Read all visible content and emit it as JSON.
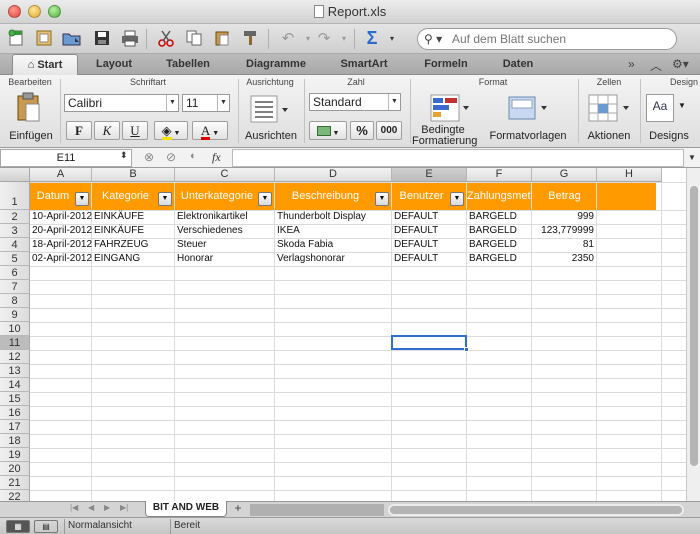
{
  "window": {
    "title": "Report.xls"
  },
  "toolbar": {
    "search": {
      "placeholder": "Auf dem Blatt suchen",
      "value": ""
    },
    "sigma": "Σ"
  },
  "ribbon_tabs": [
    {
      "label": "Start",
      "active": true
    },
    {
      "label": "Layout"
    },
    {
      "label": "Tabellen"
    },
    {
      "label": "Diagramme"
    },
    {
      "label": "SmartArt"
    },
    {
      "label": "Formeln"
    },
    {
      "label": "Daten"
    }
  ],
  "ribbon": {
    "groups": {
      "bearbeiten": "Bearbeiten",
      "schriftart": "Schriftart",
      "ausrichtung": "Ausrichtung",
      "zahl": "Zahl",
      "format": "Format",
      "zellen": "Zellen",
      "design": "Design"
    },
    "einfuegen": "Einfügen",
    "font_name": "Calibri",
    "font_size": "11",
    "bold": "F",
    "italic": "K",
    "underline": "U",
    "ausrichten": "Ausrichten",
    "number_format": "Standard",
    "percent": "%",
    "thousands": "000",
    "bedingte_1": "Bedingte",
    "bedingte_2": "Formatierung",
    "formatvorlagen": "Formatvorlagen",
    "aktionen": "Aktionen",
    "designs": "Designs",
    "design_preview": "Aa"
  },
  "formula_bar": {
    "cell_ref": "E11",
    "fx": "fx",
    "value": ""
  },
  "columns": [
    "A",
    "B",
    "C",
    "D",
    "E",
    "F",
    "G",
    "H"
  ],
  "rows": [
    "1",
    "2",
    "3",
    "4",
    "5",
    "6",
    "7",
    "8",
    "9",
    "10",
    "11",
    "12",
    "13",
    "14",
    "15",
    "16",
    "17",
    "18",
    "19",
    "20",
    "21",
    "22"
  ],
  "header_row": [
    "Datum",
    "Kategorie",
    "Unterkategorie",
    "Beschreibung",
    "Benutzer",
    "Zahlungsmethode",
    "Betrag"
  ],
  "data_rows": [
    [
      "10-April-2012",
      "EINKÄUFE",
      "Elektronikartikel",
      "Thunderbolt Display",
      "DEFAULT",
      "BARGELD",
      "999"
    ],
    [
      "20-April-2012",
      "EINKÄUFE",
      "Verschiedenes",
      "IKEA",
      "DEFAULT",
      "BARGELD",
      "123,779999"
    ],
    [
      "18-April-2012",
      "FAHRZEUG",
      "Steuer",
      "Skoda Fabia",
      "DEFAULT",
      "BARGELD",
      "81"
    ],
    [
      "02-April-2012",
      "EINGANG",
      "Honorar",
      "Verlagshonorar",
      "DEFAULT",
      "BARGELD",
      "2350"
    ]
  ],
  "selected_cell": {
    "column": "E",
    "row": "11"
  },
  "sheet_tabs": [
    {
      "label": "BIT AND WEB",
      "active": true
    }
  ],
  "status": {
    "view": "Normalansicht",
    "state": "Bereit"
  },
  "colors": {
    "header_band": "#ff9a00",
    "selection": "#2e6fd1"
  }
}
